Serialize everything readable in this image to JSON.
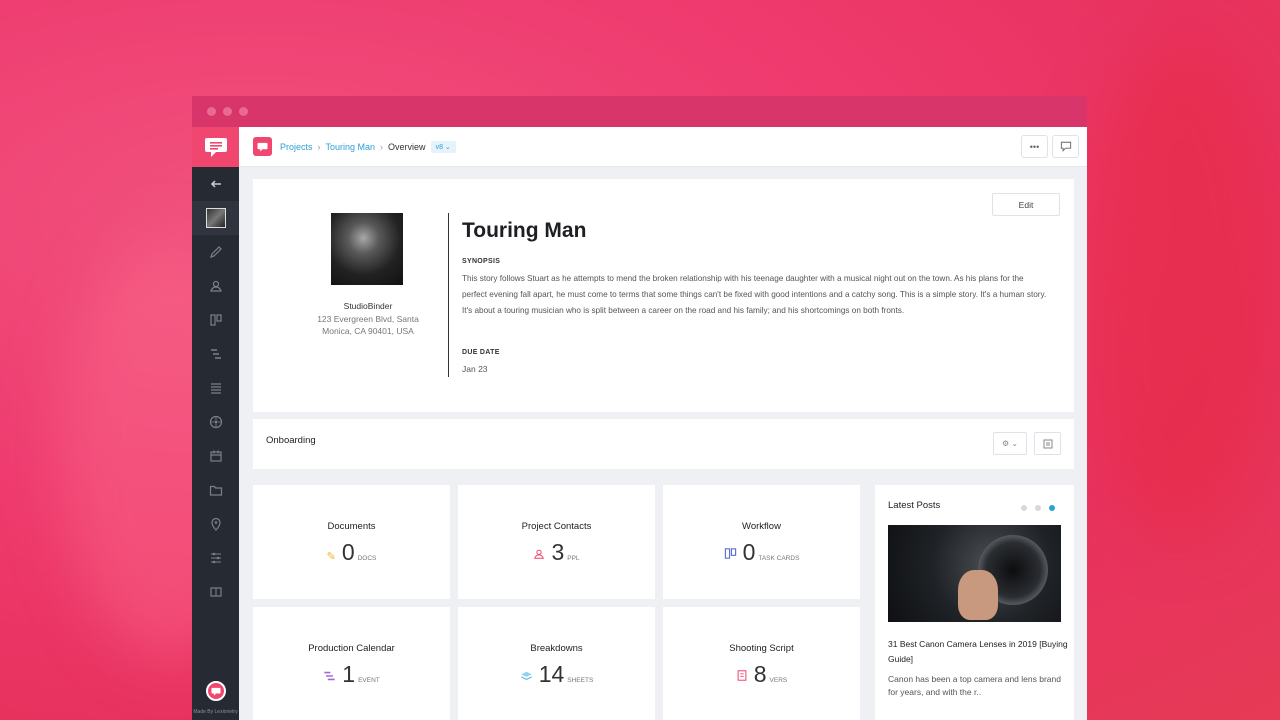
{
  "breadcrumb": {
    "projects": "Projects",
    "project": "Touring Man",
    "current": "Overview",
    "version": "v8 ⌄"
  },
  "topbar": {
    "more_label": "•••"
  },
  "project": {
    "title": "Touring Man",
    "studio": "StudioBinder",
    "address": "123 Evergreen Blvd, Santa Monica, CA 90401, USA",
    "synopsis_label": "SYNOPSIS",
    "synopsis": "This story follows Stuart as he attempts to mend the broken relationship with his teenage daughter with a musical night out on the town. As his plans for the perfect evening fall apart, he must come to terms that some things can't be fixed with good intentions and a catchy song. This is a simple story. It's a human story. It's about a touring musician who is split between a career on the road and his family; and his shortcomings on both fronts.",
    "due_label": "DUE DATE",
    "due_date": "Jan 23",
    "edit_label": "Edit"
  },
  "onboarding": {
    "title": "Onboarding",
    "settings_label": "⚙ ⌄"
  },
  "tiles": [
    {
      "title": "Documents",
      "count": "0",
      "unit": "DOCS",
      "icon": "pencil-icon",
      "color": "#f0b429"
    },
    {
      "title": "Project Contacts",
      "count": "3",
      "unit": "PPL",
      "icon": "contacts-icon",
      "color": "#ef476f"
    },
    {
      "title": "Workflow",
      "count": "0",
      "unit": "TASK CARDS",
      "icon": "workflow-icon",
      "color": "#5b6bd6"
    },
    {
      "title": "Production Calendar",
      "count": "1",
      "unit": "EVENT",
      "icon": "calendar-icon",
      "color": "#a06ad6"
    },
    {
      "title": "Breakdowns",
      "count": "14",
      "unit": "SHEETS",
      "icon": "breakdowns-icon",
      "color": "#4fb6e0"
    },
    {
      "title": "Shooting Script",
      "count": "8",
      "unit": "VERS",
      "icon": "script-icon",
      "color": "#ef476f"
    }
  ],
  "latest_posts": {
    "title": "Latest Posts",
    "post_title": "31 Best Canon Camera Lenses in 2019 [Buying Guide]",
    "post_excerpt": "Canon has been a top camera and lens brand for years, and with the r..",
    "active_dot": 3
  },
  "sidebar": {
    "made_by": "Made By Lexionetry"
  },
  "colors": {
    "brand": "#ef476f",
    "link": "#2f9fd8",
    "sidebar": "#262a33"
  }
}
